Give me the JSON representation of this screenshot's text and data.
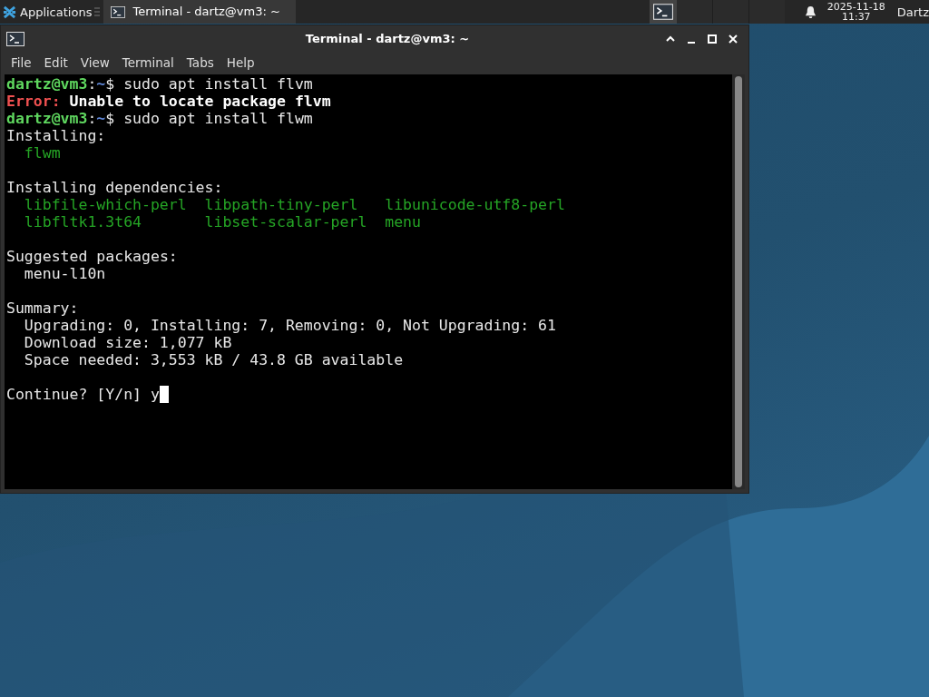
{
  "panel": {
    "apps_label": "Applications",
    "tasks": [
      {
        "title": "Terminal - dartz@vm3: ~",
        "selected": true
      }
    ],
    "clock": {
      "date": "2025-11-18",
      "time": "11:37"
    },
    "user": "Dartz"
  },
  "window": {
    "title": "Terminal - dartz@vm3: ~",
    "menu": [
      "File",
      "Edit",
      "View",
      "Terminal",
      "Tabs",
      "Help"
    ]
  },
  "terminal": {
    "lines": [
      {
        "kind": "text",
        "segments": [
          {
            "kind": "user",
            "text": "dartz@vm3"
          },
          {
            "kind": "plain",
            "text": ":"
          },
          {
            "kind": "path",
            "text": "~"
          },
          {
            "kind": "plain",
            "text": "$ sudo apt install flvm"
          }
        ]
      },
      {
        "kind": "text",
        "segments": [
          {
            "kind": "error",
            "text": "Error:"
          },
          {
            "kind": "strong",
            "text": " Unable to locate package flvm"
          }
        ]
      },
      {
        "kind": "text",
        "segments": [
          {
            "kind": "user",
            "text": "dartz@vm3"
          },
          {
            "kind": "plain",
            "text": ":"
          },
          {
            "kind": "path",
            "text": "~"
          },
          {
            "kind": "plain",
            "text": "$ sudo apt install flwm"
          }
        ]
      },
      {
        "kind": "text",
        "segments": [
          {
            "kind": "plain",
            "text": "Installing:"
          }
        ]
      },
      {
        "kind": "packages",
        "items": [
          "flwm"
        ]
      },
      {
        "kind": "blank"
      },
      {
        "kind": "text",
        "segments": [
          {
            "kind": "plain",
            "text": "Installing dependencies:"
          }
        ]
      },
      {
        "kind": "packages",
        "items": [
          "libfile-which-perl",
          "libpath-tiny-perl",
          "libunicode-utf8-perl"
        ]
      },
      {
        "kind": "packages",
        "items": [
          "libfltk1.3t64",
          "libset-scalar-perl",
          "menu"
        ]
      },
      {
        "kind": "blank"
      },
      {
        "kind": "text",
        "segments": [
          {
            "kind": "plain",
            "text": "Suggested packages:"
          }
        ]
      },
      {
        "kind": "text",
        "indented": true,
        "segments": [
          {
            "kind": "plain",
            "text": "menu-l10n"
          }
        ]
      },
      {
        "kind": "blank"
      },
      {
        "kind": "text",
        "segments": [
          {
            "kind": "plain",
            "text": "Summary:"
          }
        ]
      },
      {
        "kind": "text",
        "indented": true,
        "segments": [
          {
            "kind": "plain",
            "text": "Upgrading: 0, Installing: 7, Removing: 0, Not Upgrading: 61"
          }
        ]
      },
      {
        "kind": "text",
        "indented": true,
        "segments": [
          {
            "kind": "plain",
            "text": "Download size: 1,077 kB"
          }
        ]
      },
      {
        "kind": "text",
        "indented": true,
        "segments": [
          {
            "kind": "plain",
            "text": "Space needed: 3,553 kB / 43.8 GB available"
          }
        ]
      },
      {
        "kind": "blank"
      },
      {
        "kind": "text",
        "cursor": true,
        "segments": [
          {
            "kind": "plain",
            "text": "Continue? [Y/n] y"
          }
        ]
      }
    ]
  }
}
